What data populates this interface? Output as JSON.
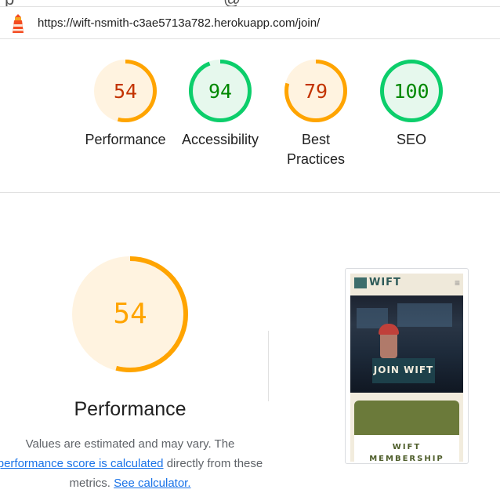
{
  "report": {
    "url": "https://wift-nsmith-c3ae5713a782.herokuapp.com/join/"
  },
  "categories": [
    {
      "label": "Performance",
      "score": 54,
      "score_text": "54",
      "status": "average"
    },
    {
      "label": "Accessibility",
      "score": 94,
      "score_text": "94",
      "status": "pass"
    },
    {
      "label": "Best Practices",
      "score": 79,
      "score_text": "79",
      "status": "average"
    },
    {
      "label": "SEO",
      "score": 100,
      "score_text": "100",
      "status": "pass"
    }
  ],
  "performance": {
    "score": 54,
    "score_text": "54",
    "title": "Performance",
    "desc_1": "Values are estimated and may vary. The",
    "link_score": "performance score is calculated",
    "desc_2": "directly from these metrics.",
    "link_calc": "See calculator."
  },
  "screenshot": {
    "logo": "WIFT",
    "menu_icon": "≡",
    "hero_button": "JOIN WIFT",
    "card_text": "WIFT MEMBERSHIP"
  },
  "colors": {
    "average": "#ffa400",
    "average_text": "#c33300",
    "average_fill": "#fff3e0",
    "pass": "#0cce6b",
    "pass_text": "#008800",
    "pass_fill": "#e6f8ed",
    "link": "#1a73e8"
  },
  "icons": [
    "lighthouse-icon",
    "hamburger-menu-icon"
  ]
}
